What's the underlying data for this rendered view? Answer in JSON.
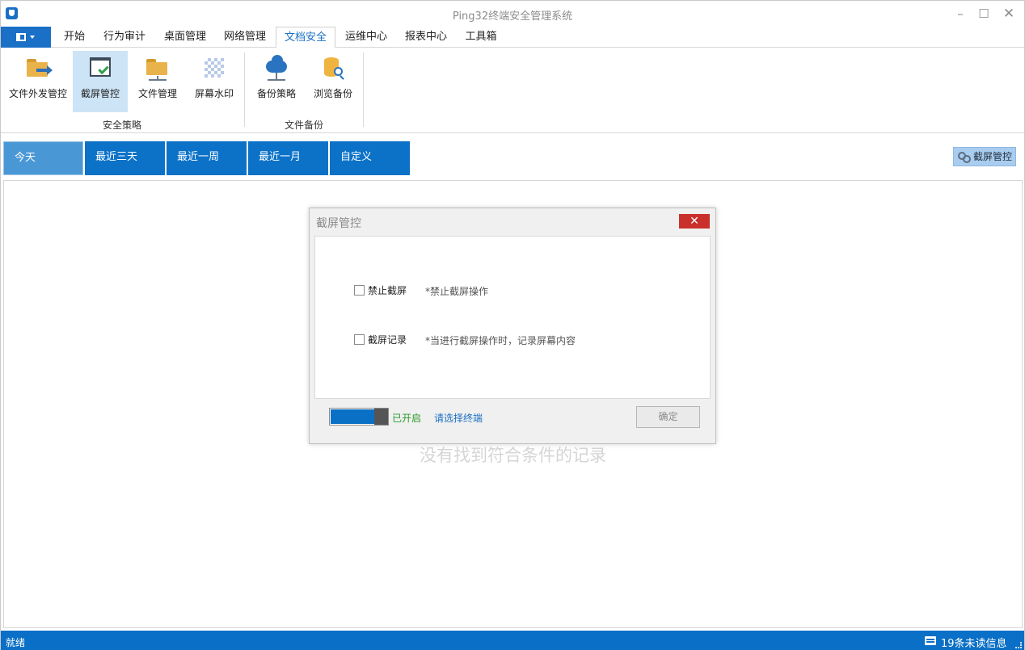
{
  "window": {
    "title": "Ping32终端安全管理系统",
    "minimize": "–",
    "maximize": "☐",
    "close": "✕"
  },
  "menu": {
    "tabs": [
      "开始",
      "行为审计",
      "桌面管理",
      "网络管理",
      "文档安全",
      "运维中心",
      "报表中心",
      "工具箱"
    ],
    "active_tab": "文档安全"
  },
  "ribbon": {
    "groups": [
      {
        "label": "安全策略",
        "buttons": [
          "文件外发管控",
          "截屏管控",
          "文件管理",
          "屏幕水印"
        ]
      },
      {
        "label": "文件备份",
        "buttons": [
          "备份策略",
          "浏览备份"
        ]
      }
    ],
    "selected_button": "截屏管控",
    "icons": [
      "folder-arrow-icon",
      "screenshot-check-icon",
      "folder-network-icon",
      "watermark-icon",
      "cloud-backup-icon",
      "database-search-icon"
    ]
  },
  "date_filter": {
    "tabs": [
      "今天",
      "最近三天",
      "最近一周",
      "最近一月",
      "自定义"
    ],
    "active": "今天"
  },
  "screen_ctrl_button": {
    "label": "截屏管控",
    "icon": "gear-icon"
  },
  "content": {
    "empty_message": "没有找到符合条件的记录"
  },
  "dialog": {
    "title": "截屏管控",
    "close_label": "✕",
    "options": [
      {
        "label": "禁止截屏",
        "note": "*禁止截屏操作",
        "checked": false
      },
      {
        "label": "截屏记录",
        "note": "*当进行截屏操作时，记录屏幕内容",
        "checked": false
      }
    ],
    "toggle_status": "已开启",
    "select_terminal": "请选择终端",
    "ok_label": "确定"
  },
  "statusbar": {
    "left_text": "就绪",
    "unread": "19条未读信息"
  },
  "colors": {
    "accent": "#0a70c6",
    "active_tab": "#4a97d6",
    "enabled_green": "#2a9a2a",
    "close_red": "#c9302c"
  }
}
